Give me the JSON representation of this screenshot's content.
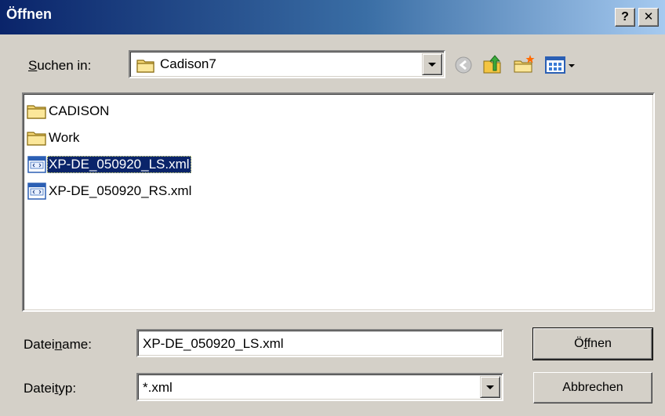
{
  "window": {
    "title": "Öffnen",
    "help_button": "?",
    "close_button": "✕"
  },
  "look_in": {
    "label_pre": "",
    "label_underlined": "S",
    "label_post": "uchen in:",
    "value": "Cadison7"
  },
  "toolbar": {
    "back_icon": "back-arrow-icon",
    "up_icon": "up-folder-icon",
    "new_folder_icon": "new-folder-icon",
    "view_menu_icon": "view-menu-icon"
  },
  "files": [
    {
      "name": "CADISON",
      "icon": "folder-icon",
      "selected": false
    },
    {
      "name": "Work",
      "icon": "folder-icon",
      "selected": false
    },
    {
      "name": "XP-DE_050920_LS.xml",
      "icon": "xml-file-icon",
      "selected": true
    },
    {
      "name": "XP-DE_050920_RS.xml",
      "icon": "xml-file-icon",
      "selected": false
    }
  ],
  "filename": {
    "label_pre": "Datei",
    "label_underlined": "n",
    "label_post": "ame:",
    "value": "XP-DE_050920_LS.xml"
  },
  "filetype": {
    "label_pre": "Datei",
    "label_underlined": "t",
    "label_post": "yp:",
    "value": "*.xml"
  },
  "buttons": {
    "open_pre": "Ö",
    "open_underlined": "f",
    "open_post": "fnen",
    "cancel": "Abbrechen"
  },
  "colors": {
    "selection": "#0a246a",
    "face": "#d4d0c8",
    "title_start": "#0a246a",
    "title_end": "#a6caf0"
  }
}
